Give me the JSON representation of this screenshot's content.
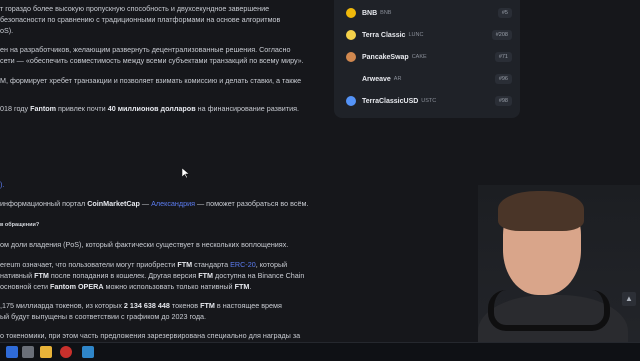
{
  "article": {
    "lines": [
      {
        "text": "т гораздо более высокую пропускную способность и двухсекундное завершение"
      },
      {
        "text": "безопасности по сравнению с традиционными платформами на основе алгоритмов"
      },
      {
        "text": "oS)."
      },
      {
        "text": "ен на разработчиков, желающим развернуть децентрализованные решения. Согласно"
      },
      {
        "text": "сети — «обеспечить совместимость между всеми субъектами транзакций по всему миру»."
      },
      {
        "text": "M, формирует хребет транзакции и позволяет взимать комиссию и делать ставки, а также"
      },
      {
        "pre": "018 году ",
        "b1": "Fantom",
        "mid": " привлек почти ",
        "b2": "40 миллионов долларов",
        "post": " на финансирование развития."
      },
      {
        "text": ")."
      },
      {
        "pre": "информационный портал ",
        "b1": "CoinMarketCap",
        "mid": " — ",
        "lnk": "Александрия",
        "post": " — поможет разобраться во всём."
      },
      {
        "text": "ом доли владения (PoS), который фактически существует в нескольких воплощениях."
      },
      {
        "pre": "ereum означает, что пользователи могут приобрести ",
        "b1": "FTM",
        "mid": " стандарта ",
        "lnk": "ERC-20",
        "post": ", который"
      },
      {
        "pre": " нативный ",
        "b1": "FTM",
        "mid": " после попадания в кошелек. Другая версия ",
        "b2": "FTM",
        "post": " доступна на Binance Chain"
      },
      {
        "pre": " основной сети ",
        "b1": "Fantom OPERA",
        "mid": " можно использовать только нативный ",
        "b2": "FTM",
        "post": "."
      },
      {
        "pre": ",175 миллиарда токенов, из которых ",
        "b1": "2 134 638 448",
        "mid": " токенов ",
        "b2": "FTM",
        "post": " в настоящее время"
      },
      {
        "text": "ый будут выпущены в соответствии с графиком до 2023 года."
      },
      {
        "text": "о токеномики, при этом часть предложения зарезервирована специально для награды за"
      }
    ],
    "subheading": "в обращении?"
  },
  "coins": [
    {
      "name": "BNB",
      "symbol": "BNB",
      "rank": "#5",
      "color": "#f0b90b"
    },
    {
      "name": "Terra Classic",
      "symbol": "LUNC",
      "rank": "#208",
      "color": "#f5d14a"
    },
    {
      "name": "PancakeSwap",
      "symbol": "CAKE",
      "rank": "#71",
      "color": "#d1884f"
    },
    {
      "name": "Arweave",
      "symbol": "AR",
      "rank": "#96",
      "color": "#e6e6e6"
    },
    {
      "name": "TerraClassicUSD",
      "symbol": "USTC",
      "rank": "#98",
      "color": "#5493f7"
    }
  ],
  "colors": {
    "link": "#5b7cf0",
    "panel": "#1f2228",
    "background": "#16171b"
  }
}
